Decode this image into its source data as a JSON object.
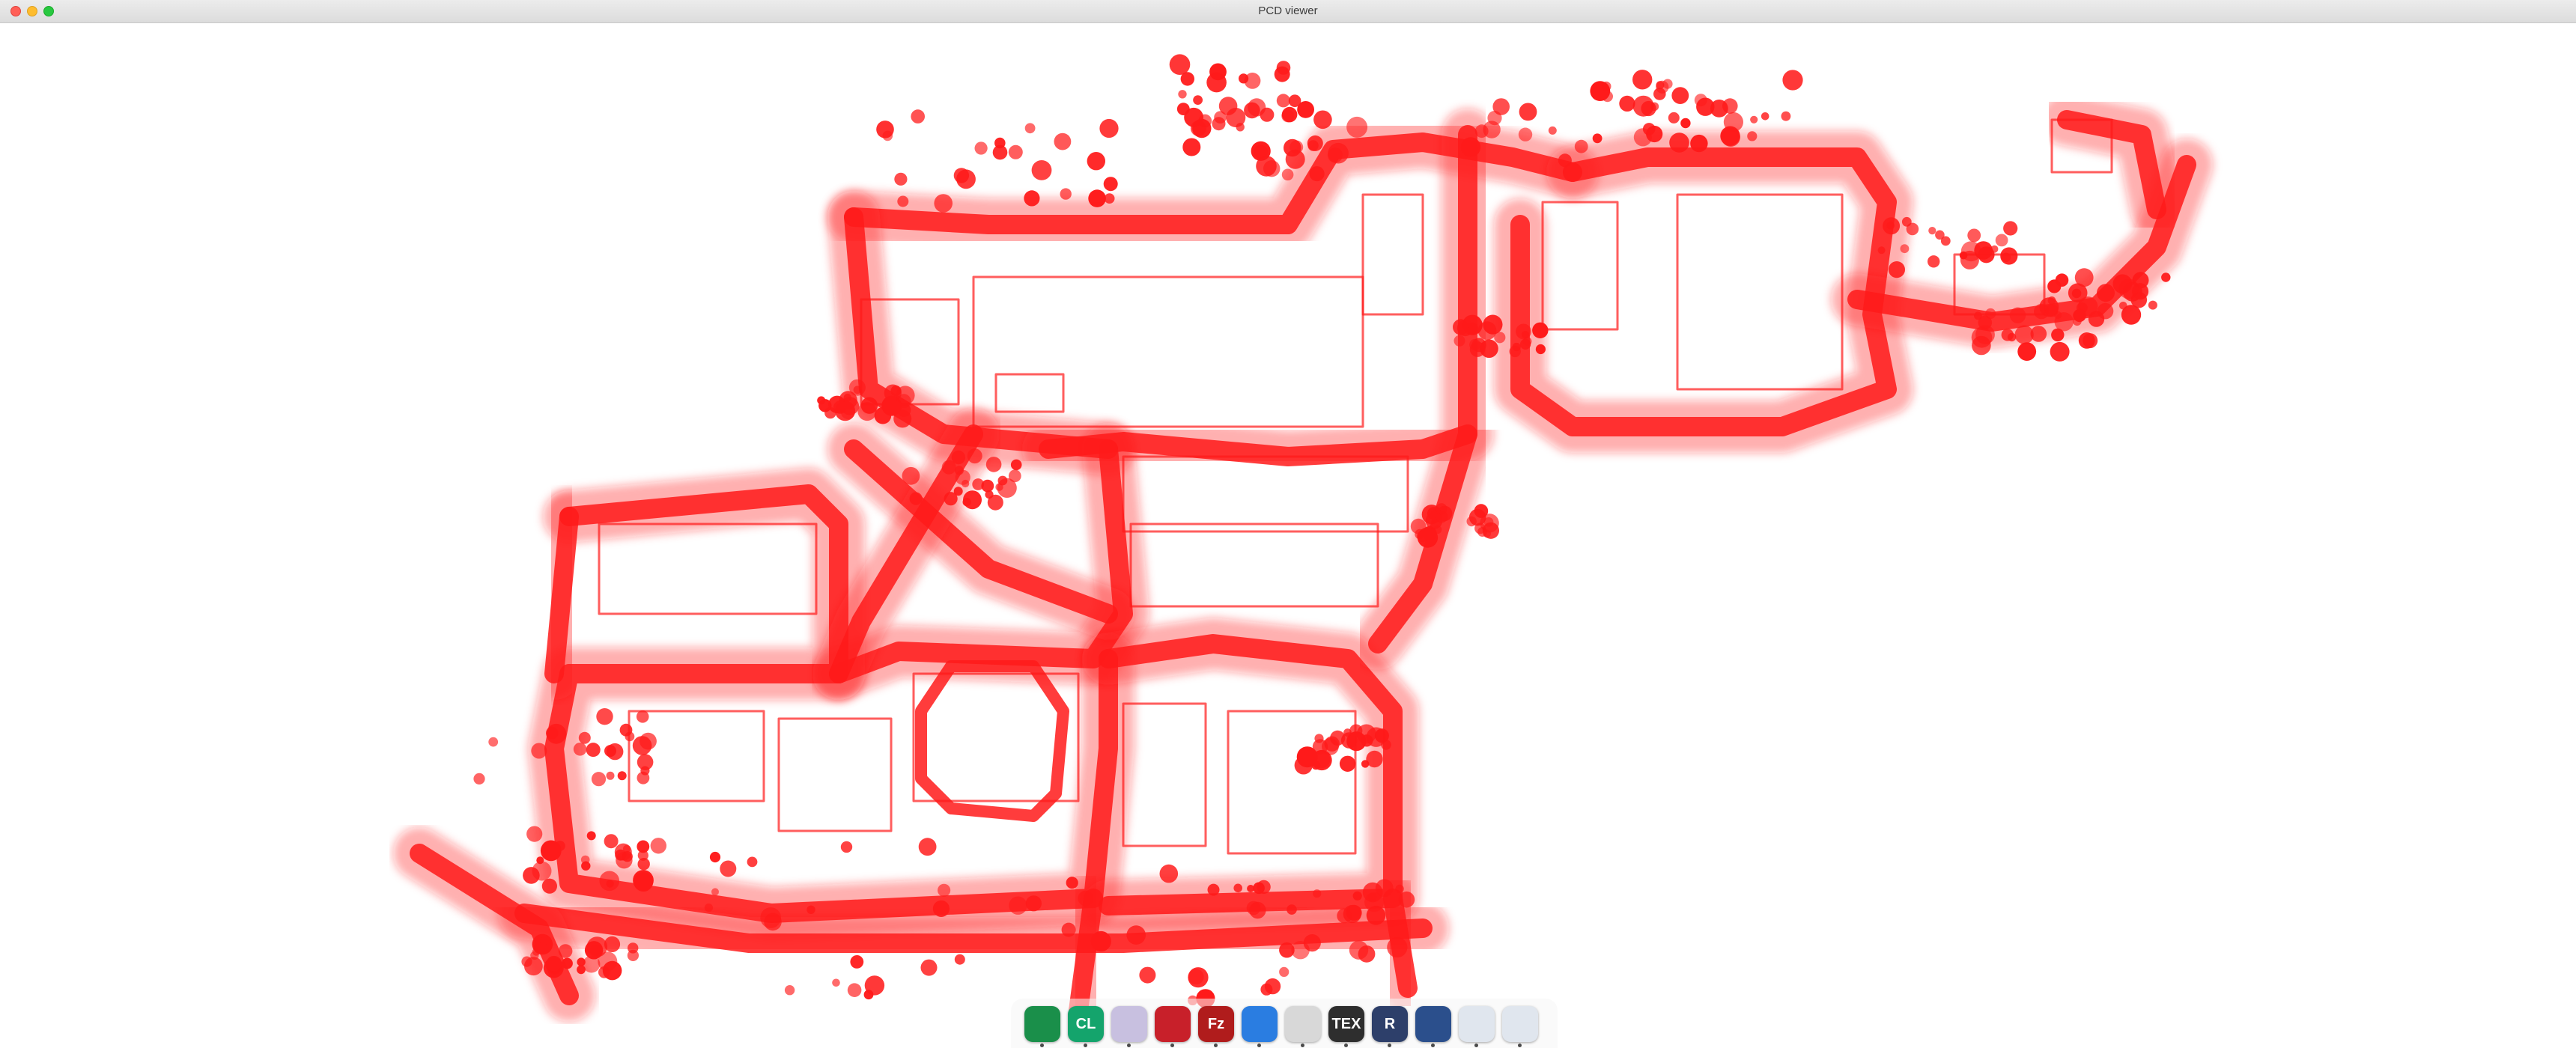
{
  "window": {
    "title": "PCD viewer"
  },
  "viewer": {
    "point_color": "#ff1a1a",
    "background": "#ffffff"
  },
  "dock": {
    "apps": [
      {
        "name": "chrome-icon",
        "glyph": "",
        "color": "#1a8f4a"
      },
      {
        "name": "clion-icon",
        "glyph": "CL",
        "color": "#14a46c"
      },
      {
        "name": "folder-icon",
        "glyph": "",
        "color": "#c8c0e0"
      },
      {
        "name": "terminal-icon",
        "glyph": "",
        "color": "#c8202a"
      },
      {
        "name": "filezilla-icon",
        "glyph": "Fz",
        "color": "#b01c1c"
      },
      {
        "name": "app-check-icon",
        "glyph": "",
        "color": "#2a7de1"
      },
      {
        "name": "settings-toggle-icon",
        "glyph": "",
        "color": "#d8d8d8"
      },
      {
        "name": "tex-icon",
        "glyph": "TEX",
        "color": "#2e2e2e"
      },
      {
        "name": "r-icon",
        "glyph": "R",
        "color": "#2d3f6a"
      },
      {
        "name": "screenshot-icon",
        "glyph": "",
        "color": "#2b4f8c"
      },
      {
        "name": "window-icon",
        "glyph": "",
        "color": "#e0e6ee"
      },
      {
        "name": "window-icon",
        "glyph": "",
        "color": "#e0e6ee"
      }
    ]
  }
}
